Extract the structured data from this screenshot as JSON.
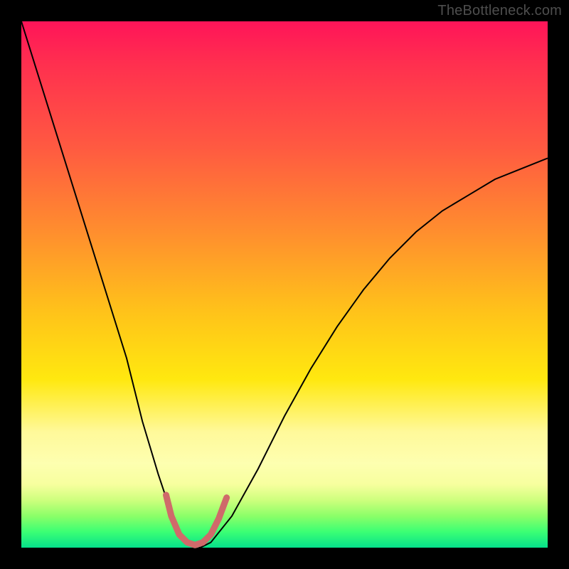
{
  "attribution": "TheBottleneck.com",
  "chart_data": {
    "type": "line",
    "title": "",
    "xlabel": "",
    "ylabel": "",
    "xlim": [
      0,
      100
    ],
    "ylim": [
      0,
      100
    ],
    "grid": false,
    "legend": false,
    "background_gradient": {
      "direction": "vertical",
      "stops": [
        {
          "pct": 0,
          "color": "#ff1459"
        },
        {
          "pct": 24,
          "color": "#ff5a41"
        },
        {
          "pct": 55,
          "color": "#ffc21a"
        },
        {
          "pct": 78,
          "color": "#fff99a"
        },
        {
          "pct": 94,
          "color": "#8bff68"
        },
        {
          "pct": 100,
          "color": "#05e08a"
        }
      ]
    },
    "series": [
      {
        "name": "bottleneck-curve",
        "color": "#000000",
        "width": 2,
        "x": [
          0,
          5,
          10,
          15,
          20,
          23,
          26,
          28,
          30,
          32,
          34,
          36,
          40,
          45,
          50,
          55,
          60,
          65,
          70,
          75,
          80,
          85,
          90,
          95,
          100
        ],
        "y": [
          100,
          84,
          68,
          52,
          36,
          24,
          14,
          8,
          3,
          1,
          0,
          1,
          6,
          15,
          25,
          34,
          42,
          49,
          55,
          60,
          64,
          67,
          70,
          72,
          74
        ]
      },
      {
        "name": "valley-marker",
        "color": "#cf6a6a",
        "width": 9,
        "linecap": "round",
        "x": [
          27.5,
          28.5,
          30.0,
          31.5,
          33.0,
          34.5,
          36.0,
          37.5,
          39.0
        ],
        "y": [
          10.0,
          6.0,
          2.5,
          1.0,
          0.5,
          1.0,
          2.5,
          5.5,
          9.5
        ]
      }
    ]
  }
}
